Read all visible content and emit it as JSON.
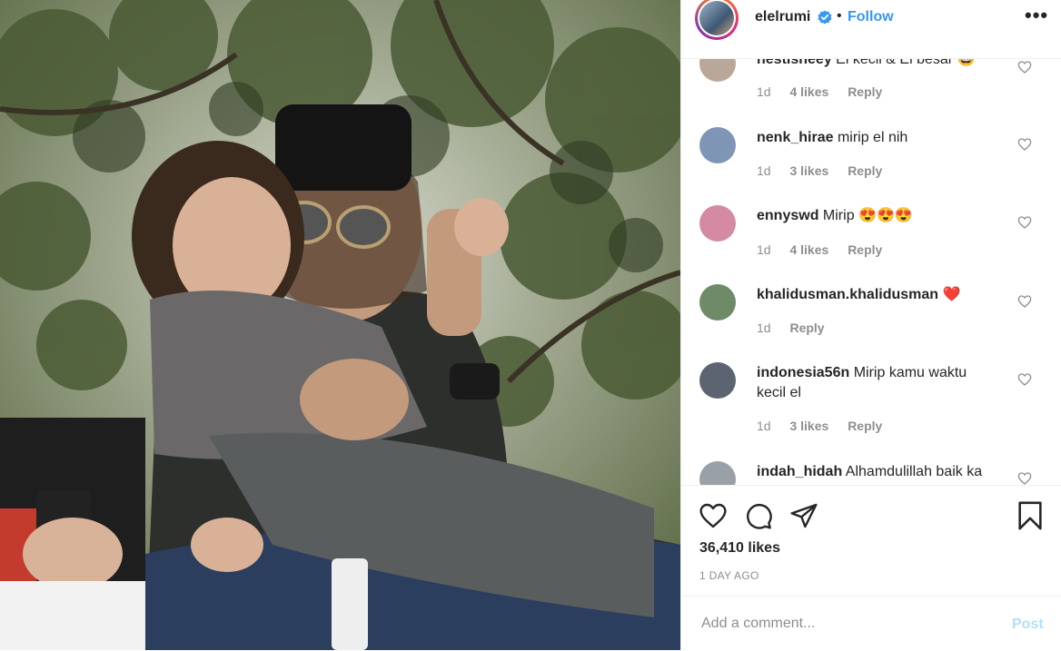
{
  "header": {
    "username": "elelrumi",
    "separator": "•",
    "follow_label": "Follow",
    "more_label": "•••",
    "verified": true
  },
  "comments": [
    {
      "username": "nestisheey",
      "text": "El kecil & El besar 😅",
      "time": "1d",
      "likes": "4 likes",
      "reply": "Reply",
      "avatar_color": "#b9a89a"
    },
    {
      "username": "nenk_hirae",
      "text": "mirip el nih",
      "time": "1d",
      "likes": "3 likes",
      "reply": "Reply",
      "avatar_color": "#7f95b5"
    },
    {
      "username": "ennyswd",
      "text": "Mirip 😍😍😍",
      "time": "1d",
      "likes": "4 likes",
      "reply": "Reply",
      "avatar_color": "#d48aa3"
    },
    {
      "username": "khalidusman.khalidusman",
      "text": "❤️",
      "time": "1d",
      "likes": "",
      "reply": "Reply",
      "avatar_color": "#6f8a66"
    },
    {
      "username": "indonesia56n",
      "text": "Mirip kamu waktu kecil el",
      "time": "1d",
      "likes": "3 likes",
      "reply": "Reply",
      "avatar_color": "#5b6470"
    },
    {
      "username": "indah_hidah",
      "text": "Alhamdulillah baik ka",
      "time": "",
      "likes": "",
      "reply": "",
      "avatar_color": "#9aa0a8"
    }
  ],
  "actions": {
    "like_icon": "heart-icon",
    "comment_icon": "comment-icon",
    "share_icon": "share-icon",
    "save_icon": "bookmark-icon"
  },
  "likes_count": "36,410 likes",
  "timestamp": "1 DAY AGO",
  "add_comment": {
    "placeholder": "Add a comment...",
    "post_label": "Post"
  },
  "colors": {
    "accent": "#3897f0",
    "post_disabled": "#b2dffc",
    "muted": "#8e8e8e",
    "text": "#262626"
  }
}
